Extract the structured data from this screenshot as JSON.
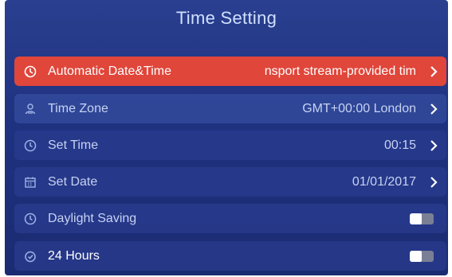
{
  "header": {
    "title": "Time Setting"
  },
  "rows": [
    {
      "label": "Automatic Date&Time",
      "value": "nsport stream-provided tim",
      "icon": "clock-sync-icon",
      "control": "chevron"
    },
    {
      "label": "Time Zone",
      "value": "GMT+00:00 London",
      "icon": "globe-person-icon",
      "control": "chevron"
    },
    {
      "label": "Set Time",
      "value": "00:15",
      "icon": "clock-icon",
      "control": "chevron"
    },
    {
      "label": "Set Date",
      "value": "01/01/2017",
      "icon": "calendar-icon",
      "control": "chevron"
    },
    {
      "label": "Daylight Saving",
      "value": "",
      "icon": "clock-icon",
      "control": "toggle",
      "state": "off"
    },
    {
      "label": "24 Hours",
      "value": "",
      "icon": "timer-icon",
      "control": "toggle",
      "state": "off"
    }
  ],
  "colors": {
    "highlight": "#e0463a",
    "panel": "#1f3280"
  }
}
